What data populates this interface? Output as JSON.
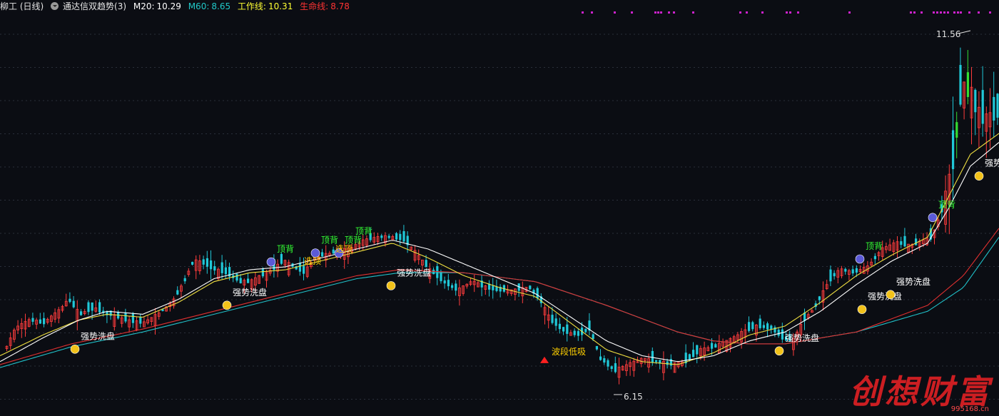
{
  "header": {
    "stock": "柳工 (日线)",
    "indicator": "通达信双趋势(3)",
    "m20": {
      "label": "M20:",
      "value": "10.29",
      "color": "#ffffff"
    },
    "m60": {
      "label": "M60:",
      "value": "8.65",
      "color": "#20c8c8"
    },
    "work": {
      "label": "工作线:",
      "value": "10.31",
      "color": "#ffff33"
    },
    "life": {
      "label": "生命线:",
      "value": "8.78",
      "color": "#ff3333"
    }
  },
  "colors": {
    "background": "#0b0d13",
    "up": "#ff3c3c",
    "down": "#20c8d8",
    "green_bar": "#33dd33",
    "m20_line": "#ffffff",
    "work_line": "#f0e040",
    "life_line": "#e03030",
    "m60_line": "#20c0c8",
    "top_signal": "#33ff33",
    "wash_signal": "#ffffff",
    "dot_signal": "#cc22cc"
  },
  "chart_data": {
    "type": "candlestick",
    "y_range": [
      5.8,
      12.3
    ],
    "price_high_label": "11.56",
    "price_low_label": "6.15",
    "price_path": [
      [
        0,
        6.55
      ],
      [
        20,
        7.05
      ],
      [
        40,
        7.2
      ],
      [
        60,
        7.15
      ],
      [
        85,
        7.4
      ],
      [
        95,
        7.55
      ],
      [
        110,
        7.3
      ],
      [
        130,
        7.4
      ],
      [
        150,
        7.3
      ],
      [
        175,
        7.2
      ],
      [
        200,
        7.15
      ],
      [
        220,
        7.3
      ],
      [
        240,
        7.5
      ],
      [
        255,
        7.8
      ],
      [
        270,
        8.2
      ],
      [
        285,
        8.15
      ],
      [
        300,
        8.05
      ],
      [
        315,
        8.0
      ],
      [
        335,
        7.85
      ],
      [
        350,
        7.85
      ],
      [
        365,
        7.95
      ],
      [
        380,
        8.05
      ],
      [
        395,
        8.2
      ],
      [
        410,
        8.1
      ],
      [
        425,
        8.0
      ],
      [
        440,
        8.25
      ],
      [
        455,
        8.3
      ],
      [
        470,
        8.35
      ],
      [
        490,
        8.4
      ],
      [
        510,
        8.55
      ],
      [
        530,
        8.6
      ],
      [
        550,
        8.6
      ],
      [
        565,
        8.55
      ],
      [
        580,
        8.35
      ],
      [
        600,
        8.05
      ],
      [
        620,
        7.85
      ],
      [
        640,
        7.7
      ],
      [
        660,
        7.85
      ],
      [
        680,
        7.75
      ],
      [
        700,
        7.7
      ],
      [
        720,
        7.7
      ],
      [
        740,
        7.75
      ],
      [
        755,
        7.55
      ],
      [
        770,
        7.2
      ],
      [
        790,
        7.0
      ],
      [
        810,
        6.95
      ],
      [
        825,
        7.05
      ],
      [
        840,
        6.55
      ],
      [
        860,
        6.35
      ],
      [
        880,
        6.45
      ],
      [
        900,
        6.55
      ],
      [
        920,
        6.5
      ],
      [
        940,
        6.45
      ],
      [
        960,
        6.5
      ],
      [
        980,
        6.7
      ],
      [
        1000,
        6.75
      ],
      [
        1020,
        6.85
      ],
      [
        1040,
        7.0
      ],
      [
        1060,
        7.1
      ],
      [
        1080,
        7.05
      ],
      [
        1095,
        6.9
      ],
      [
        1110,
        6.85
      ],
      [
        1125,
        7.2
      ],
      [
        1140,
        7.4
      ],
      [
        1160,
        7.85
      ],
      [
        1175,
        8.05
      ],
      [
        1195,
        8.0
      ],
      [
        1215,
        8.1
      ],
      [
        1235,
        8.4
      ],
      [
        1255,
        8.5
      ],
      [
        1275,
        8.45
      ],
      [
        1295,
        8.55
      ],
      [
        1305,
        8.6
      ],
      [
        1320,
        9.1
      ],
      [
        1335,
        9.9
      ],
      [
        1345,
        11.0
      ],
      [
        1355,
        11.3
      ],
      [
        1365,
        10.8
      ],
      [
        1375,
        10.6
      ],
      [
        1385,
        10.6
      ],
      [
        1400,
        10.75
      ]
    ],
    "green_bar_segments": [
      [
        1336,
        1340
      ],
      [
        1346,
        1349
      ],
      [
        1353,
        1357
      ]
    ],
    "lines": {
      "m20": [
        [
          0,
          6.5
        ],
        [
          60,
          6.9
        ],
        [
          110,
          7.2
        ],
        [
          150,
          7.35
        ],
        [
          200,
          7.3
        ],
        [
          250,
          7.55
        ],
        [
          300,
          7.9
        ],
        [
          350,
          8.05
        ],
        [
          400,
          8.1
        ],
        [
          450,
          8.25
        ],
        [
          500,
          8.4
        ],
        [
          550,
          8.55
        ],
        [
          600,
          8.4
        ],
        [
          650,
          8.15
        ],
        [
          700,
          7.9
        ],
        [
          750,
          7.65
        ],
        [
          800,
          7.25
        ],
        [
          850,
          6.85
        ],
        [
          900,
          6.6
        ],
        [
          950,
          6.5
        ],
        [
          1000,
          6.6
        ],
        [
          1050,
          6.85
        ],
        [
          1100,
          7.0
        ],
        [
          1150,
          7.35
        ],
        [
          1200,
          7.8
        ],
        [
          1250,
          8.2
        ],
        [
          1300,
          8.5
        ],
        [
          1330,
          9.1
        ],
        [
          1360,
          9.8
        ],
        [
          1400,
          10.2
        ]
      ],
      "work": [
        [
          0,
          6.6
        ],
        [
          60,
          6.95
        ],
        [
          110,
          7.2
        ],
        [
          150,
          7.3
        ],
        [
          200,
          7.25
        ],
        [
          250,
          7.5
        ],
        [
          300,
          7.85
        ],
        [
          350,
          8.0
        ],
        [
          400,
          8.05
        ],
        [
          450,
          8.2
        ],
        [
          500,
          8.35
        ],
        [
          550,
          8.5
        ],
        [
          600,
          8.25
        ],
        [
          650,
          7.95
        ],
        [
          700,
          7.75
        ],
        [
          750,
          7.6
        ],
        [
          800,
          7.15
        ],
        [
          850,
          6.7
        ],
        [
          900,
          6.5
        ],
        [
          950,
          6.45
        ],
        [
          1000,
          6.65
        ],
        [
          1050,
          6.95
        ],
        [
          1100,
          7.1
        ],
        [
          1150,
          7.5
        ],
        [
          1200,
          7.95
        ],
        [
          1250,
          8.3
        ],
        [
          1300,
          8.6
        ],
        [
          1330,
          9.3
        ],
        [
          1360,
          10.0
        ],
        [
          1400,
          10.35
        ]
      ],
      "life": [
        [
          0,
          6.45
        ],
        [
          100,
          6.8
        ],
        [
          200,
          7.05
        ],
        [
          300,
          7.35
        ],
        [
          400,
          7.65
        ],
        [
          500,
          7.95
        ],
        [
          560,
          8.05
        ],
        [
          650,
          8.0
        ],
        [
          750,
          7.85
        ],
        [
          850,
          7.45
        ],
        [
          950,
          7.0
        ],
        [
          1000,
          6.85
        ],
        [
          1050,
          6.8
        ],
        [
          1100,
          6.8
        ],
        [
          1200,
          7.0
        ],
        [
          1300,
          7.45
        ],
        [
          1350,
          7.95
        ],
        [
          1400,
          8.75
        ]
      ],
      "m60": [
        [
          0,
          6.4
        ],
        [
          100,
          6.75
        ],
        [
          200,
          7.0
        ],
        [
          300,
          7.3
        ],
        [
          400,
          7.6
        ],
        [
          500,
          7.9
        ],
        [
          560,
          8.0
        ],
        [
          650,
          8.0
        ],
        [
          750,
          7.85
        ],
        [
          850,
          7.45
        ],
        [
          950,
          7.0
        ],
        [
          1000,
          6.85
        ],
        [
          1050,
          6.8
        ],
        [
          1100,
          6.8
        ],
        [
          1200,
          7.0
        ],
        [
          1300,
          7.35
        ],
        [
          1350,
          7.75
        ],
        [
          1400,
          8.6
        ]
      ]
    },
    "annotations": [
      {
        "text": "强势洗盘",
        "x": 125,
        "y": 6.88,
        "face": "smile",
        "type": "wash"
      },
      {
        "text": "强势洗盘",
        "x": 338,
        "y": 7.62,
        "face": "smile",
        "type": "wash"
      },
      {
        "text": "强势洗盘",
        "x": 568,
        "y": 7.95,
        "face": "smile",
        "type": "wash"
      },
      {
        "text": "强势洗盘",
        "x": 1112,
        "y": 6.85,
        "face": "smile",
        "type": "wash"
      },
      {
        "text": "强势洗盘",
        "x": 1228,
        "y": 7.55,
        "face": "smile",
        "type": "wash"
      },
      {
        "text": "强势洗盘",
        "x": 1268,
        "y": 7.8,
        "face": "smile",
        "type": "wash"
      },
      {
        "text": "强势",
        "x": 1392,
        "y": 9.8,
        "face": "smile",
        "type": "wash"
      },
      {
        "text": "顶背",
        "x": 400,
        "y": 8.35,
        "face": "sad",
        "type": "top"
      },
      {
        "text": "顶背",
        "x": 462,
        "y": 8.5,
        "face": "sad",
        "type": "top"
      },
      {
        "text": "顶背",
        "x": 495,
        "y": 8.5,
        "face": "sad",
        "type": "top"
      },
      {
        "text": "顶背",
        "x": 510,
        "y": 8.65,
        "face": "none",
        "type": "top"
      },
      {
        "text": "顶背",
        "x": 1225,
        "y": 8.4,
        "face": "sad",
        "type": "top"
      },
      {
        "text": "顶背",
        "x": 1327,
        "y": 9.1,
        "face": "sad",
        "type": "top"
      },
      {
        "text": "选顶",
        "x": 438,
        "y": 8.15,
        "face": "none",
        "type": "wash"
      },
      {
        "text": "选顶",
        "x": 482,
        "y": 8.35,
        "face": "none",
        "type": "wash"
      },
      {
        "text": "波段低吸",
        "x": 785,
        "y": 6.62,
        "face": "triangle",
        "type": "buy"
      }
    ],
    "dot_signals_x": [
      815,
      828,
      860,
      884,
      917,
      921,
      925,
      936,
      943,
      970,
      1036,
      1045,
      1067,
      1101,
      1106,
      1117,
      1189,
      1275,
      1280,
      1290,
      1307,
      1312,
      1317,
      1322,
      1327,
      1336,
      1341,
      1345,
      1357,
      1370,
      1386
    ]
  },
  "watermark": {
    "main": "创想财富",
    "sub": "995168.cn"
  }
}
